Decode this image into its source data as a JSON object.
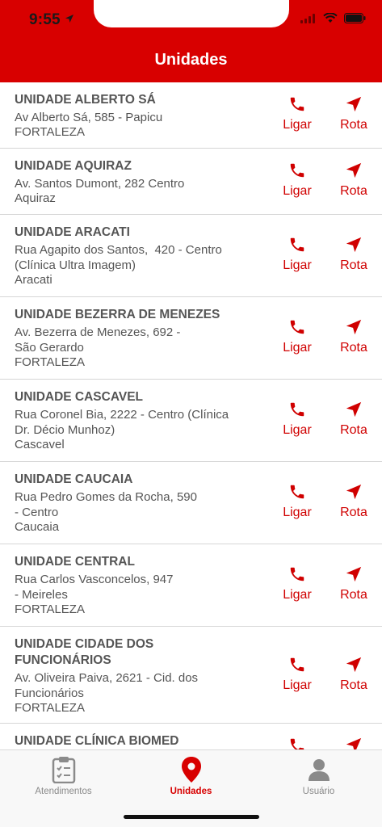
{
  "status_bar": {
    "time": "9:55"
  },
  "header": {
    "title": "Unidades"
  },
  "actions": {
    "call_label": "Ligar",
    "route_label": "Rota"
  },
  "colors": {
    "brand": "#d80000",
    "text": "#555555",
    "tab_inactive": "#8a8a8a"
  },
  "units": [
    {
      "name": "UNIDADE ALBERTO SÁ",
      "address": [
        "Av Alberto Sá, 585 - Papicu"
      ],
      "city": "FORTALEZA"
    },
    {
      "name": "UNIDADE AQUIRAZ",
      "address": [
        "Av. Santos Dumont, 282 Centro"
      ],
      "city": "Aquiraz"
    },
    {
      "name": "UNIDADE ARACATI",
      "address": [
        "Rua Agapito dos Santos,  420 - Centro",
        "(Clínica Ultra Imagem)"
      ],
      "city": "Aracati"
    },
    {
      "name": "UNIDADE BEZERRA DE MENEZES",
      "address": [
        "Av. Bezerra de Menezes, 692 -",
        "São Gerardo"
      ],
      "city": "FORTALEZA"
    },
    {
      "name": "UNIDADE CASCAVEL",
      "address": [
        "Rua Coronel Bia, 2222 - Centro (Clínica",
        "Dr. Décio Munhoz)"
      ],
      "city": "Cascavel"
    },
    {
      "name": "UNIDADE CAUCAIA",
      "address": [
        "Rua Pedro Gomes da Rocha, 590",
        "- Centro"
      ],
      "city": "Caucaia"
    },
    {
      "name": "UNIDADE CENTRAL",
      "address": [
        "Rua Carlos Vasconcelos, 947",
        "- Meireles"
      ],
      "city": "FORTALEZA"
    },
    {
      "name": "UNIDADE CIDADE DOS FUNCIONÁRIOS",
      "address": [
        "Av. Oliveira Paiva, 2621 - Cid. dos",
        "Funcionários"
      ],
      "city": "FORTALEZA"
    },
    {
      "name": "UNIDADE CLÍNICA BIOMED",
      "address": [],
      "city": ""
    }
  ],
  "tabbar": {
    "tabs": [
      {
        "label": "Atendimentos",
        "icon": "clipboard-icon",
        "active": false
      },
      {
        "label": "Unidades",
        "icon": "map-pin-icon",
        "active": true
      },
      {
        "label": "Usuário",
        "icon": "user-icon",
        "active": false
      }
    ]
  }
}
